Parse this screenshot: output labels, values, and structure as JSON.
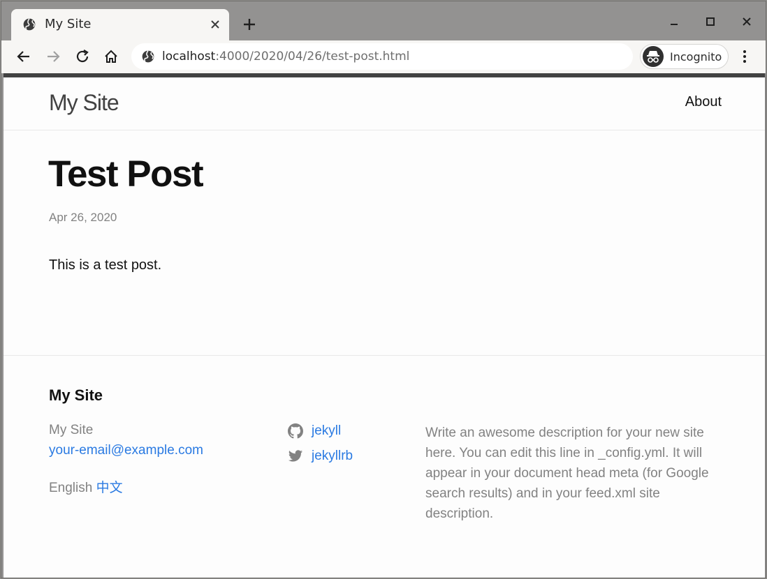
{
  "browser": {
    "tab_title": "My Site",
    "url_host": "localhost",
    "url_rest": ":4000/2020/04/26/test-post.html",
    "incognito_label": "Incognito"
  },
  "header": {
    "site_title": "My Site",
    "nav_about": "About"
  },
  "post": {
    "title": "Test Post",
    "date": "Apr 26, 2020",
    "body": "This is a test post."
  },
  "footer": {
    "heading": "My Site",
    "name": "My Site",
    "email": "your-email@example.com",
    "lang_current": "English",
    "lang_other": "中文",
    "social": [
      {
        "icon": "github-icon",
        "label": "jekyll"
      },
      {
        "icon": "twitter-icon",
        "label": "jekyllrb"
      }
    ],
    "description": "Write an awesome description for your new site here. You can edit this line in _config.yml. It will appear in your document head meta (for Google search results) and in your feed.xml site description."
  },
  "colors": {
    "link": "#2a7ae2",
    "muted_text": "#828282",
    "header_bar": "#424242"
  }
}
